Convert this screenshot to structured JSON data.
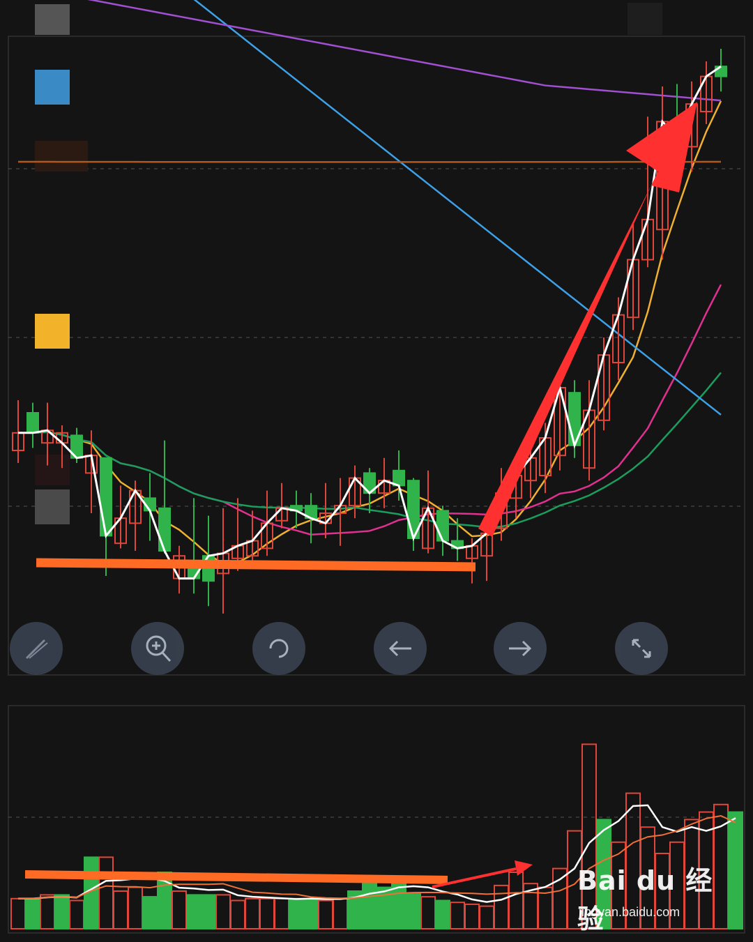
{
  "chart_data": [
    {
      "type": "candlestick",
      "panel": "price",
      "title": "",
      "xlabel": "",
      "ylabel": "",
      "grid": true,
      "ylim": [
        0,
        100
      ],
      "up_color": "#e0463a",
      "down_color": "#2fb34a",
      "candles": [
        {
          "o": 65,
          "c": 72,
          "h": 85,
          "l": 60,
          "dir": "up"
        },
        {
          "o": 80,
          "c": 72,
          "h": 84,
          "l": 66,
          "dir": "down"
        },
        {
          "o": 68,
          "c": 73,
          "h": 84,
          "l": 59,
          "dir": "up"
        },
        {
          "o": 72,
          "c": 68,
          "h": 75,
          "l": 58,
          "dir": "up"
        },
        {
          "o": 71,
          "c": 62,
          "h": 74,
          "l": 60,
          "dir": "down"
        },
        {
          "o": 56,
          "c": 63,
          "h": 73,
          "l": 40,
          "dir": "up"
        },
        {
          "o": 62,
          "c": 31,
          "h": 62,
          "l": 15,
          "dir": "down"
        },
        {
          "o": 28,
          "c": 38,
          "h": 51,
          "l": 26,
          "dir": "up"
        },
        {
          "o": 36,
          "c": 49,
          "h": 53,
          "l": 25,
          "dir": "up"
        },
        {
          "o": 46,
          "c": 41,
          "h": 56,
          "l": 29,
          "dir": "down"
        },
        {
          "o": 42,
          "c": 25,
          "h": 69,
          "l": 24,
          "dir": "down"
        },
        {
          "o": 23,
          "c": 14,
          "h": 27,
          "l": 8,
          "dir": "up"
        },
        {
          "o": 20,
          "c": 14,
          "h": 46,
          "l": 8,
          "dir": "down"
        },
        {
          "o": 13,
          "c": 23,
          "h": 39,
          "l": 3,
          "dir": "down"
        },
        {
          "o": 16,
          "c": 24,
          "h": 42,
          "l": 0,
          "dir": "up"
        },
        {
          "o": 22,
          "c": 27,
          "h": 46,
          "l": 17,
          "dir": "up"
        },
        {
          "o": 23,
          "c": 29,
          "h": 41,
          "l": 19,
          "dir": "up"
        },
        {
          "o": 26,
          "c": 36,
          "h": 49,
          "l": 23,
          "dir": "up"
        },
        {
          "o": 37,
          "c": 42,
          "h": 52,
          "l": 34,
          "dir": "up"
        },
        {
          "o": 43,
          "c": 41,
          "h": 49,
          "l": 34,
          "dir": "down"
        },
        {
          "o": 43,
          "c": 38,
          "h": 48,
          "l": 28,
          "dir": "down"
        },
        {
          "o": 40,
          "c": 36,
          "h": 52,
          "l": 30,
          "dir": "up"
        },
        {
          "o": 40,
          "c": 43,
          "h": 54,
          "l": 27,
          "dir": "up"
        },
        {
          "o": 43,
          "c": 54,
          "h": 59,
          "l": 38,
          "dir": "up"
        },
        {
          "o": 56,
          "c": 48,
          "h": 58,
          "l": 40,
          "dir": "down"
        },
        {
          "o": 48,
          "c": 53,
          "h": 62,
          "l": 42,
          "dir": "up"
        },
        {
          "o": 57,
          "c": 51,
          "h": 65,
          "l": 45,
          "dir": "down"
        },
        {
          "o": 53,
          "c": 30,
          "h": 54,
          "l": 25,
          "dir": "down"
        },
        {
          "o": 26,
          "c": 42,
          "h": 57,
          "l": 24,
          "dir": "up"
        },
        {
          "o": 41,
          "c": 29,
          "h": 43,
          "l": 23,
          "dir": "down"
        },
        {
          "o": 29,
          "c": 26,
          "h": 38,
          "l": 21,
          "dir": "down"
        },
        {
          "o": 22,
          "c": 27,
          "h": 30,
          "l": 12,
          "dir": "up"
        },
        {
          "o": 23,
          "c": 32,
          "h": 38,
          "l": 13,
          "dir": "up"
        },
        {
          "o": 34,
          "c": 48,
          "h": 58,
          "l": 29,
          "dir": "up"
        },
        {
          "o": 46,
          "c": 55,
          "h": 63,
          "l": 38,
          "dir": "up"
        },
        {
          "o": 53,
          "c": 62,
          "h": 68,
          "l": 46,
          "dir": "up"
        },
        {
          "o": 55,
          "c": 70,
          "h": 76,
          "l": 48,
          "dir": "up"
        },
        {
          "o": 63,
          "c": 90,
          "h": 97,
          "l": 57,
          "dir": "up"
        },
        {
          "o": 88,
          "c": 67,
          "h": 93,
          "l": 62,
          "dir": "down"
        },
        {
          "o": 58,
          "c": 81,
          "h": 93,
          "l": 53,
          "dir": "up"
        },
        {
          "o": 77,
          "c": 103,
          "h": 110,
          "l": 73,
          "dir": "up"
        },
        {
          "o": 100,
          "c": 119,
          "h": 126,
          "l": 93,
          "dir": "up"
        },
        {
          "o": 118,
          "c": 141,
          "h": 155,
          "l": 113,
          "dir": "up"
        },
        {
          "o": 141,
          "c": 157,
          "h": 198,
          "l": 138,
          "dir": "up"
        },
        {
          "o": 153,
          "c": 196,
          "h": 210,
          "l": 141,
          "dir": "up"
        },
        {
          "o": 195,
          "c": 190,
          "h": 211,
          "l": 178,
          "dir": "down"
        },
        {
          "o": 186,
          "c": 203,
          "h": 212,
          "l": 176,
          "dir": "up"
        },
        {
          "o": 200,
          "c": 214,
          "h": 220,
          "l": 195,
          "dir": "up"
        },
        {
          "o": 214,
          "c": 218,
          "h": 225,
          "l": 208,
          "dir": "down"
        }
      ]
    },
    {
      "type": "bar",
      "panel": "volume",
      "title": "",
      "grid": true,
      "ylim": [
        0,
        100
      ],
      "bars": [
        {
          "v": 16,
          "dir": "up"
        },
        {
          "v": 16,
          "dir": "down"
        },
        {
          "v": 18,
          "dir": "up"
        },
        {
          "v": 18,
          "dir": "down"
        },
        {
          "v": 15,
          "dir": "up"
        },
        {
          "v": 38,
          "dir": "down"
        },
        {
          "v": 38,
          "dir": "up"
        },
        {
          "v": 20,
          "dir": "up"
        },
        {
          "v": 22,
          "dir": "up"
        },
        {
          "v": 17,
          "dir": "down"
        },
        {
          "v": 30,
          "dir": "down"
        },
        {
          "v": 20,
          "dir": "up"
        },
        {
          "v": 18,
          "dir": "down"
        },
        {
          "v": 18,
          "dir": "down"
        },
        {
          "v": 18,
          "dir": "up"
        },
        {
          "v": 15,
          "dir": "up"
        },
        {
          "v": 16,
          "dir": "up"
        },
        {
          "v": 16,
          "dir": "up"
        },
        {
          "v": 16,
          "dir": "up"
        },
        {
          "v": 16,
          "dir": "down"
        },
        {
          "v": 16,
          "dir": "down"
        },
        {
          "v": 15,
          "dir": "up"
        },
        {
          "v": 16,
          "dir": "up"
        },
        {
          "v": 20,
          "dir": "down"
        },
        {
          "v": 26,
          "dir": "down"
        },
        {
          "v": 22,
          "dir": "down"
        },
        {
          "v": 26,
          "dir": "down"
        },
        {
          "v": 19,
          "dir": "down"
        },
        {
          "v": 17,
          "dir": "up"
        },
        {
          "v": 15,
          "dir": "down"
        },
        {
          "v": 14,
          "dir": "up"
        },
        {
          "v": 13,
          "dir": "up"
        },
        {
          "v": 12,
          "dir": "up"
        },
        {
          "v": 23,
          "dir": "up"
        },
        {
          "v": 30,
          "dir": "up"
        },
        {
          "v": 24,
          "dir": "up"
        },
        {
          "v": 22,
          "dir": "up"
        },
        {
          "v": 32,
          "dir": "up"
        },
        {
          "v": 52,
          "dir": "up"
        },
        {
          "v": 98,
          "dir": "up"
        },
        {
          "v": 58,
          "dir": "down"
        },
        {
          "v": 46,
          "dir": "up"
        },
        {
          "v": 72,
          "dir": "up"
        },
        {
          "v": 54,
          "dir": "up"
        },
        {
          "v": 40,
          "dir": "up"
        },
        {
          "v": 46,
          "dir": "up"
        },
        {
          "v": 58,
          "dir": "up"
        },
        {
          "v": 62,
          "dir": "up"
        },
        {
          "v": 66,
          "dir": "up"
        },
        {
          "v": 62,
          "dir": "down"
        }
      ]
    }
  ],
  "moving_average_colors": {
    "white": "#ffffff",
    "yellow": "#f0b030",
    "pink": "#e03090",
    "green": "#1a9e5e",
    "blue": "#3ea0e6",
    "brown": "#b05820",
    "purple": "#a050d0"
  },
  "annotation_colors": {
    "support_line": "#ff6a24",
    "arrow": "#ff3030"
  },
  "controls": [
    {
      "name": "draw-tool-button",
      "icon": "pencil-icon"
    },
    {
      "name": "zoom-in-button",
      "icon": "zoom-in-icon"
    },
    {
      "name": "refresh-button",
      "icon": "refresh-icon"
    },
    {
      "name": "prev-button",
      "icon": "arrow-left-icon"
    },
    {
      "name": "next-button",
      "icon": "arrow-right-icon"
    },
    {
      "name": "fullscreen-button",
      "icon": "expand-icon"
    }
  ],
  "watermark": {
    "brand": "Bai du 经验",
    "url": "jingyan.baidu.com"
  }
}
